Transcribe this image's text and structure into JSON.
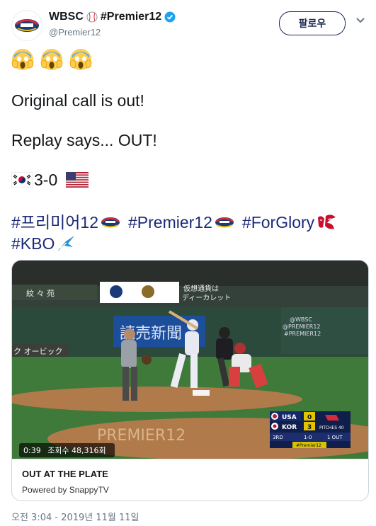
{
  "account": {
    "display_name": "WBSC",
    "display_name_tag": "#Premier12",
    "handle": "@Premier12",
    "follow_label": "팔로우"
  },
  "tweet": {
    "line2": "Original call is out!",
    "line3": "Replay says... OUT!",
    "score": "3-0",
    "hashtags": [
      "#프리미어12",
      "#Premier12",
      "#ForGlory",
      "#KBO"
    ]
  },
  "card": {
    "title": "OUT AT THE PLATE",
    "subtitle": "Powered by SnappyTV",
    "video": {
      "duration": "0:39",
      "views": "조회수 48,316회",
      "scoreboard": {
        "team1": "USA",
        "team1_score": "0",
        "team2": "KOR",
        "team2_score": "3",
        "pitches": "PITCHES 40",
        "inning": "3RD",
        "count": "1-0",
        "outs": "1 OUT",
        "tag": "#Premier12"
      },
      "ads": {
        "left": "紋 々 苑",
        "center": "仮想通貨は\nディーカレット",
        "yomiuri": "読売新聞",
        "wbsc": "@WBSC\n#PREMIER12",
        "olympic": "ク オービック",
        "field": "PREMIER12"
      }
    }
  },
  "timestamp": "오전 3:04 - 2019년 11월 11일",
  "colors": {
    "hashtag": "#1b2a78",
    "follow_border": "#1b2a52",
    "verified": "#1da1f2"
  }
}
